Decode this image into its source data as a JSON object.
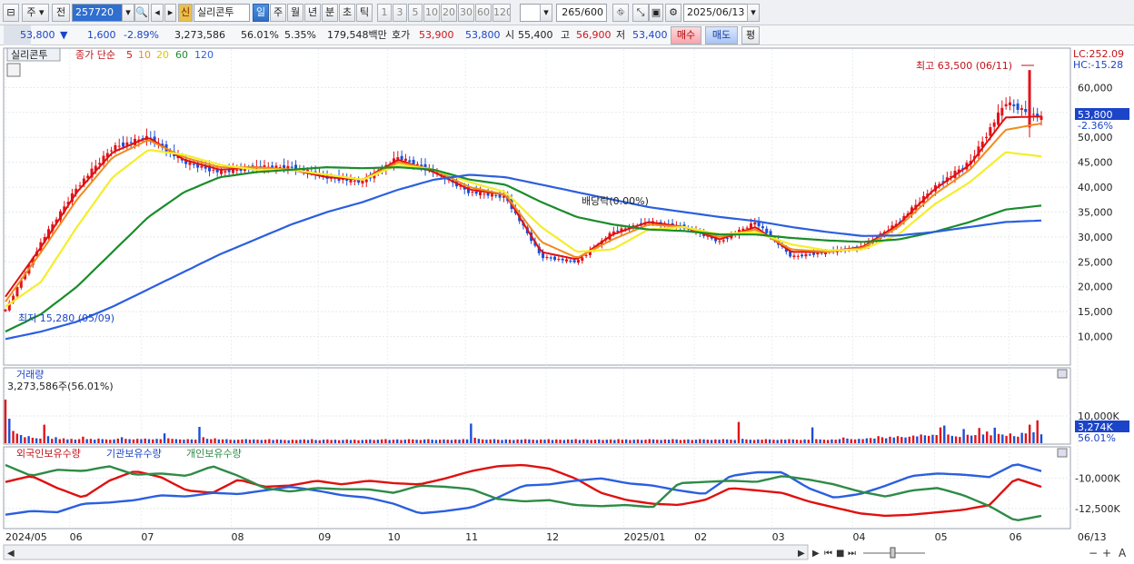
{
  "toolbar": {
    "market_label": "주",
    "prev_label": "전",
    "code_value": "257720",
    "new_badge": "신",
    "stock_name": "실리콘투",
    "period_tabs": [
      "일",
      "주",
      "월",
      "년",
      "분",
      "초",
      "틱"
    ],
    "active_period": "일",
    "interval_buttons": [
      "1",
      "3",
      "5",
      "10",
      "20",
      "30",
      "60",
      "120"
    ],
    "count_value": "265",
    "count_total": "/600",
    "date_value": "2025/06/13"
  },
  "quote": {
    "price": "53,800",
    "arrow": "▼",
    "change": "1,600",
    "change_pct": "-2.89%",
    "volume": "3,273,586",
    "vol_ratio": "56.01%",
    "turnover": "5.35%",
    "amount": "179,548백만",
    "ask_label": "호가",
    "ask_price": "53,900",
    "bid_price": "53,800",
    "open_label": "시",
    "open_price": "55,400",
    "high_label": "고",
    "high_price": "56,900",
    "low_label": "저",
    "low_price": "53,400",
    "buy_label": "매수",
    "sell_label": "매도",
    "eval_label": "평"
  },
  "colors": {
    "up": "#e0141b",
    "down": "#1a4fd8",
    "ma5": "#e01010",
    "ma10": "#f08a1c",
    "ma20": "#f4ee2a",
    "ma60": "#1a8c2c",
    "ma120": "#2b5fe0",
    "foreign": "#e01010",
    "institution": "#2b5fe0",
    "individual": "#2e8b46"
  },
  "chart_data": [
    {
      "type": "line",
      "title": "실리콘투",
      "legend": [
        "종가 단순",
        "5",
        "10",
        "20",
        "60",
        "120"
      ],
      "legend_placement": "top-left",
      "x_tick_labels": [
        "2024/05",
        "06",
        "07",
        "08",
        "09",
        "10",
        "11",
        "12",
        "2025/01",
        "02",
        "03",
        "04",
        "05",
        "06",
        "06/13"
      ],
      "y_ticks": [
        "60,000",
        "55,000",
        "50,000",
        "45,000",
        "40,000",
        "35,000",
        "30,000",
        "25,000",
        "20,000",
        "15,000",
        "10,000"
      ],
      "ylim": [
        5000,
        67000
      ],
      "grid": true,
      "current_price_label": "53,800",
      "current_change_label": "-2.36%",
      "lc_label": "LC:252.09",
      "hc_label": "HC:-15.28",
      "annotations": {
        "max": "최고 63,500 (06/11)",
        "min": "최저 15,280 (05/09)",
        "event": "배당락(0.00%)"
      },
      "series": [
        {
          "name": "종가",
          "x": [
            "2024-05-09",
            "2024-05-20",
            "2024-06-01",
            "2024-06-15",
            "2024-06-25",
            "2024-07-05",
            "2024-07-15",
            "2024-08-01",
            "2024-08-15",
            "2024-09-01",
            "2024-09-15",
            "2024-10-01",
            "2024-10-15",
            "2024-11-01",
            "2024-11-15",
            "2024-12-01",
            "2024-12-15",
            "2025-01-01",
            "2025-01-15",
            "2025-02-01",
            "2025-02-15",
            "2025-03-01",
            "2025-03-15",
            "2025-04-01",
            "2025-04-15",
            "2025-05-01",
            "2025-05-15",
            "2025-06-01",
            "2025-06-11",
            "2025-06-13"
          ],
          "values": [
            15280,
            29000,
            40000,
            48000,
            50000,
            45000,
            43000,
            44000,
            44000,
            42000,
            41000,
            46000,
            43000,
            39000,
            38000,
            26000,
            25000,
            31000,
            33000,
            32000,
            29000,
            33000,
            26000,
            27000,
            28000,
            33000,
            40000,
            45000,
            57000,
            53800
          ]
        },
        {
          "name": "5",
          "values": [
            18000,
            28000,
            39000,
            47000,
            50000,
            45500,
            43500,
            44000,
            43500,
            42000,
            41500,
            45500,
            43000,
            39500,
            38500,
            27000,
            25500,
            30500,
            33000,
            32000,
            29500,
            32000,
            27000,
            27000,
            28000,
            32500,
            39500,
            44500,
            54000,
            54200
          ]
        },
        {
          "name": "10",
          "values": [
            17000,
            27000,
            37500,
            46000,
            49500,
            46000,
            44000,
            44000,
            43500,
            42500,
            41500,
            45000,
            43500,
            40000,
            38500,
            29000,
            25800,
            29500,
            32500,
            32000,
            30000,
            31500,
            27500,
            27000,
            27800,
            32000,
            38500,
            43500,
            51500,
            52800
          ]
        },
        {
          "name": "20",
          "values": [
            16000,
            21000,
            32000,
            42000,
            47500,
            46500,
            44500,
            43500,
            43500,
            42500,
            41500,
            44500,
            43500,
            41000,
            39000,
            32000,
            27000,
            27500,
            31500,
            32000,
            30500,
            31000,
            28500,
            27300,
            27500,
            30500,
            36500,
            41000,
            47000,
            46200
          ]
        },
        {
          "name": "60",
          "values": [
            11000,
            14500,
            20000,
            27000,
            34000,
            39000,
            42000,
            43000,
            43500,
            44000,
            43800,
            44000,
            43500,
            41500,
            40500,
            37000,
            34000,
            32500,
            31500,
            31200,
            30500,
            30500,
            29800,
            29300,
            29000,
            29500,
            31000,
            33000,
            35500,
            36300
          ]
        },
        {
          "name": "120",
          "values": [
            9500,
            11000,
            13000,
            16000,
            19500,
            23000,
            26500,
            29500,
            32500,
            35000,
            37000,
            39500,
            41500,
            42500,
            42000,
            40500,
            39000,
            37500,
            36000,
            35000,
            34000,
            33200,
            32000,
            31000,
            30200,
            30300,
            31000,
            32000,
            33000,
            33300
          ]
        }
      ]
    },
    {
      "type": "bar",
      "title": "거래량",
      "label_value": "3,273,586주(56.01%)",
      "y_ticks": [
        "10,000K"
      ],
      "current_label": "3,274K",
      "current_ratio": "56.01%",
      "ylim": [
        0,
        16000
      ],
      "unit": "K",
      "values": [
        16000,
        9000,
        4500,
        3500,
        3000,
        2200,
        2600,
        2000,
        1800,
        1700,
        6800,
        2600,
        1600,
        2200,
        1500,
        1800,
        1400,
        1600,
        1300,
        1500,
        2400,
        1500,
        1600,
        1300,
        1700,
        1500,
        1400,
        1300,
        1400,
        1700,
        2200,
        1600,
        1500,
        1400,
        1600,
        1500,
        1700,
        1500,
        1400,
        1600,
        1500,
        3600,
        1800,
        1600,
        1500,
        1400,
        1300,
        1500,
        1400,
        1300,
        6000,
        2200,
        1600,
        1500,
        1800,
        1400,
        1400,
        1500,
        1300,
        1200,
        1300,
        1400,
        1500,
        1300,
        1400,
        1300,
        1200,
        1300,
        1500,
        1200,
        1400,
        1300,
        1200,
        1100,
        1300,
        1200,
        1300,
        1400,
        1200,
        1500,
        1200,
        1100,
        1300,
        1400,
        1200,
        1300,
        1100,
        1200,
        1400,
        1200,
        1300,
        1100,
        1200,
        1300,
        1400,
        1200,
        1300,
        1400,
        1500,
        1200,
        1300,
        1400,
        1200,
        1300,
        1500,
        1400,
        1300,
        1200,
        1400,
        1500,
        1300,
        1200,
        1300,
        1400,
        1300,
        1200,
        1400,
        1300,
        1500,
        1400,
        7200,
        2000,
        1600,
        1400,
        1300,
        1400,
        1500,
        1300,
        1200,
        1400,
        1300,
        1200,
        1400,
        1300,
        1500,
        1400,
        1300,
        1200,
        1400,
        1300,
        1500,
        1200,
        1400,
        1300,
        1200,
        1400,
        1300,
        1500,
        1200,
        1400,
        1300,
        1200,
        1300,
        1400,
        1200,
        1300,
        1400,
        1200,
        1500,
        1300,
        1400,
        1200,
        1300,
        1400,
        1200,
        1300,
        1500,
        1400,
        1300,
        1200,
        1400,
        1300,
        1500,
        1400,
        1200,
        1300,
        1400,
        1200,
        1300,
        1500,
        1400,
        1300,
        1200,
        1400,
        1300,
        1500,
        1400,
        1300,
        1200,
        7800,
        1600,
        1400,
        1300,
        1200,
        1400,
        1300,
        1500,
        1400,
        1300,
        1200,
        1400,
        1300,
        1500,
        1400,
        1300,
        1200,
        1400,
        1300,
        5800,
        1500,
        1400,
        1300,
        1200,
        1400,
        1300,
        1500,
        2100,
        1700,
        1500,
        1400,
        1600,
        1500,
        1800,
        1900,
        1700,
        2600,
        2200,
        1800,
        2400,
        2100,
        2600,
        2300,
        2100,
        2400,
        2800,
        2500,
        3200,
        2900,
        2700,
        3100,
        3000,
        5800,
        6500,
        3200,
        2700,
        2500,
        2300,
        5200,
        3100,
        2800,
        3000,
        5600,
        3200,
        4300,
        2900,
        5700,
        3400,
        3200,
        2700,
        3600,
        2600,
        2400,
        3800,
        3600,
        6800,
        4000,
        8400,
        3274
      ],
      "up_flags": [
        1,
        0,
        1,
        1,
        0,
        1,
        0,
        1,
        0,
        1,
        1,
        0,
        1,
        0,
        1,
        1,
        0,
        1,
        0,
        1,
        1,
        0,
        1,
        0,
        1,
        0,
        1,
        1,
        0,
        1,
        0,
        1,
        0,
        1,
        1,
        0,
        1,
        0,
        1,
        0,
        1,
        0,
        1,
        1,
        0,
        1,
        0,
        1,
        0,
        1,
        0,
        1,
        0,
        1,
        1,
        0,
        1,
        0,
        1,
        0,
        1,
        1,
        0,
        1,
        0,
        1,
        0,
        1,
        1,
        0,
        1,
        0,
        1,
        0,
        1,
        1,
        0,
        1,
        0,
        1,
        0,
        1,
        0,
        1,
        1,
        0,
        1,
        0,
        1,
        0,
        1,
        1,
        0,
        1,
        0,
        1,
        0,
        1,
        1,
        0,
        1,
        0,
        1,
        0,
        1,
        1,
        0,
        1,
        0,
        1,
        0,
        0,
        1,
        0,
        1,
        0,
        1,
        0,
        1,
        0,
        0,
        1,
        0,
        1,
        0,
        1,
        0,
        1,
        0,
        0,
        1,
        0,
        1,
        0,
        1,
        0,
        1,
        0,
        1,
        0,
        1,
        0,
        1,
        1,
        0,
        1,
        0,
        1,
        0,
        1,
        0,
        1,
        1,
        0,
        1,
        0,
        1,
        0,
        1,
        1,
        0,
        1,
        0,
        1,
        0,
        1,
        1,
        0,
        1,
        0,
        1,
        0,
        1,
        0,
        1,
        1,
        0,
        1,
        0,
        1,
        0,
        1,
        0,
        1,
        0,
        1,
        0,
        1,
        0,
        1,
        0,
        1,
        0,
        1,
        0,
        1,
        1,
        0,
        1,
        0,
        1,
        0,
        1,
        0,
        1,
        1,
        0,
        1,
        0,
        1,
        0,
        1,
        1,
        0,
        1,
        0,
        1,
        0,
        1,
        1,
        0,
        1,
        0,
        1,
        0,
        1,
        1,
        0,
        1,
        0,
        1,
        1,
        0,
        1,
        1,
        0,
        1,
        0,
        1,
        0,
        1,
        1,
        0,
        1,
        0,
        1,
        1,
        0,
        1,
        0,
        1,
        1,
        0,
        1,
        1,
        0,
        1,
        0,
        1,
        1,
        0,
        1,
        0,
        1,
        1,
        0,
        1,
        0
      ]
    },
    {
      "type": "line",
      "legend": [
        "외국인보유수량",
        "기관보유수량",
        "개인보유수량"
      ],
      "y_ticks": [
        "-10,000K",
        "-12,500K"
      ],
      "series": [
        {
          "name": "외국인보유수량",
          "values": [
            -10300,
            -9800,
            -10800,
            -11600,
            -10200,
            -9400,
            -9900,
            -11000,
            -11200,
            -10100,
            -10700,
            -10600,
            -10200,
            -10500,
            -10200,
            -10400,
            -10500,
            -10000,
            -9400,
            -9000,
            -8900,
            -9200,
            -10000,
            -11200,
            -11800,
            -12100,
            -12200,
            -11800,
            -10800,
            -11000,
            -11200,
            -11900,
            -12400,
            -12900,
            -13100,
            -13000,
            -12800,
            -12600,
            -12200,
            -10000,
            -10700
          ]
        },
        {
          "name": "기관보유수량",
          "values": [
            -13000,
            -12700,
            -12800,
            -12100,
            -12000,
            -11800,
            -11400,
            -11500,
            -11200,
            -11300,
            -11000,
            -10700,
            -11000,
            -11400,
            -11600,
            -12100,
            -12900,
            -12700,
            -12400,
            -11600,
            -10600,
            -10500,
            -10200,
            -10000,
            -10400,
            -10600,
            -11000,
            -11300,
            -9800,
            -9500,
            -9500,
            -10800,
            -11600,
            -11300,
            -10600,
            -9800,
            -9600,
            -9700,
            -9900,
            -8800,
            -9400
          ]
        },
        {
          "name": "개인보유수량",
          "values": [
            -8900,
            -9800,
            -9300,
            -9400,
            -9000,
            -9700,
            -9600,
            -9800,
            -9000,
            -9800,
            -10800,
            -11100,
            -10800,
            -10900,
            -10900,
            -11200,
            -10600,
            -10700,
            -10900,
            -11700,
            -11900,
            -11800,
            -12200,
            -12300,
            -12200,
            -12400,
            -10400,
            -10300,
            -10200,
            -10300,
            -9800,
            -10100,
            -10500,
            -11100,
            -11500,
            -11000,
            -10800,
            -11400,
            -12300,
            -13500,
            -13100
          ]
        }
      ]
    }
  ],
  "panels": {
    "volume_title": "거래량"
  },
  "bottom_nav": {
    "scroll_left": "◀",
    "scroll_right": "▶",
    "nav_buttons": [
      "▶",
      "⏮",
      "■",
      "⏭"
    ],
    "zoom_minus": "−",
    "zoom_plus": "+",
    "font_button": "A"
  }
}
